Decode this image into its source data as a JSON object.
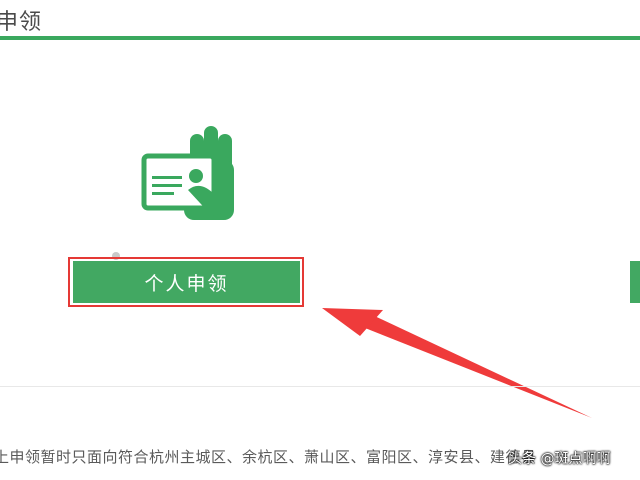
{
  "header": {
    "title": "申领"
  },
  "main": {
    "apply_button_label": "个人申领"
  },
  "notice": {
    "text": "上申领暂时只面向符合杭州主城区、余杭区、萧山区、富阳区、淳安县、建德县"
  },
  "watermark": {
    "text": "头条 @斑点啊啊"
  },
  "colors": {
    "brand_green": "#3aa85e",
    "highlight_red": "#e53935"
  },
  "icons": {
    "card": "id-card-hand-icon",
    "arrow": "red-arrow"
  }
}
